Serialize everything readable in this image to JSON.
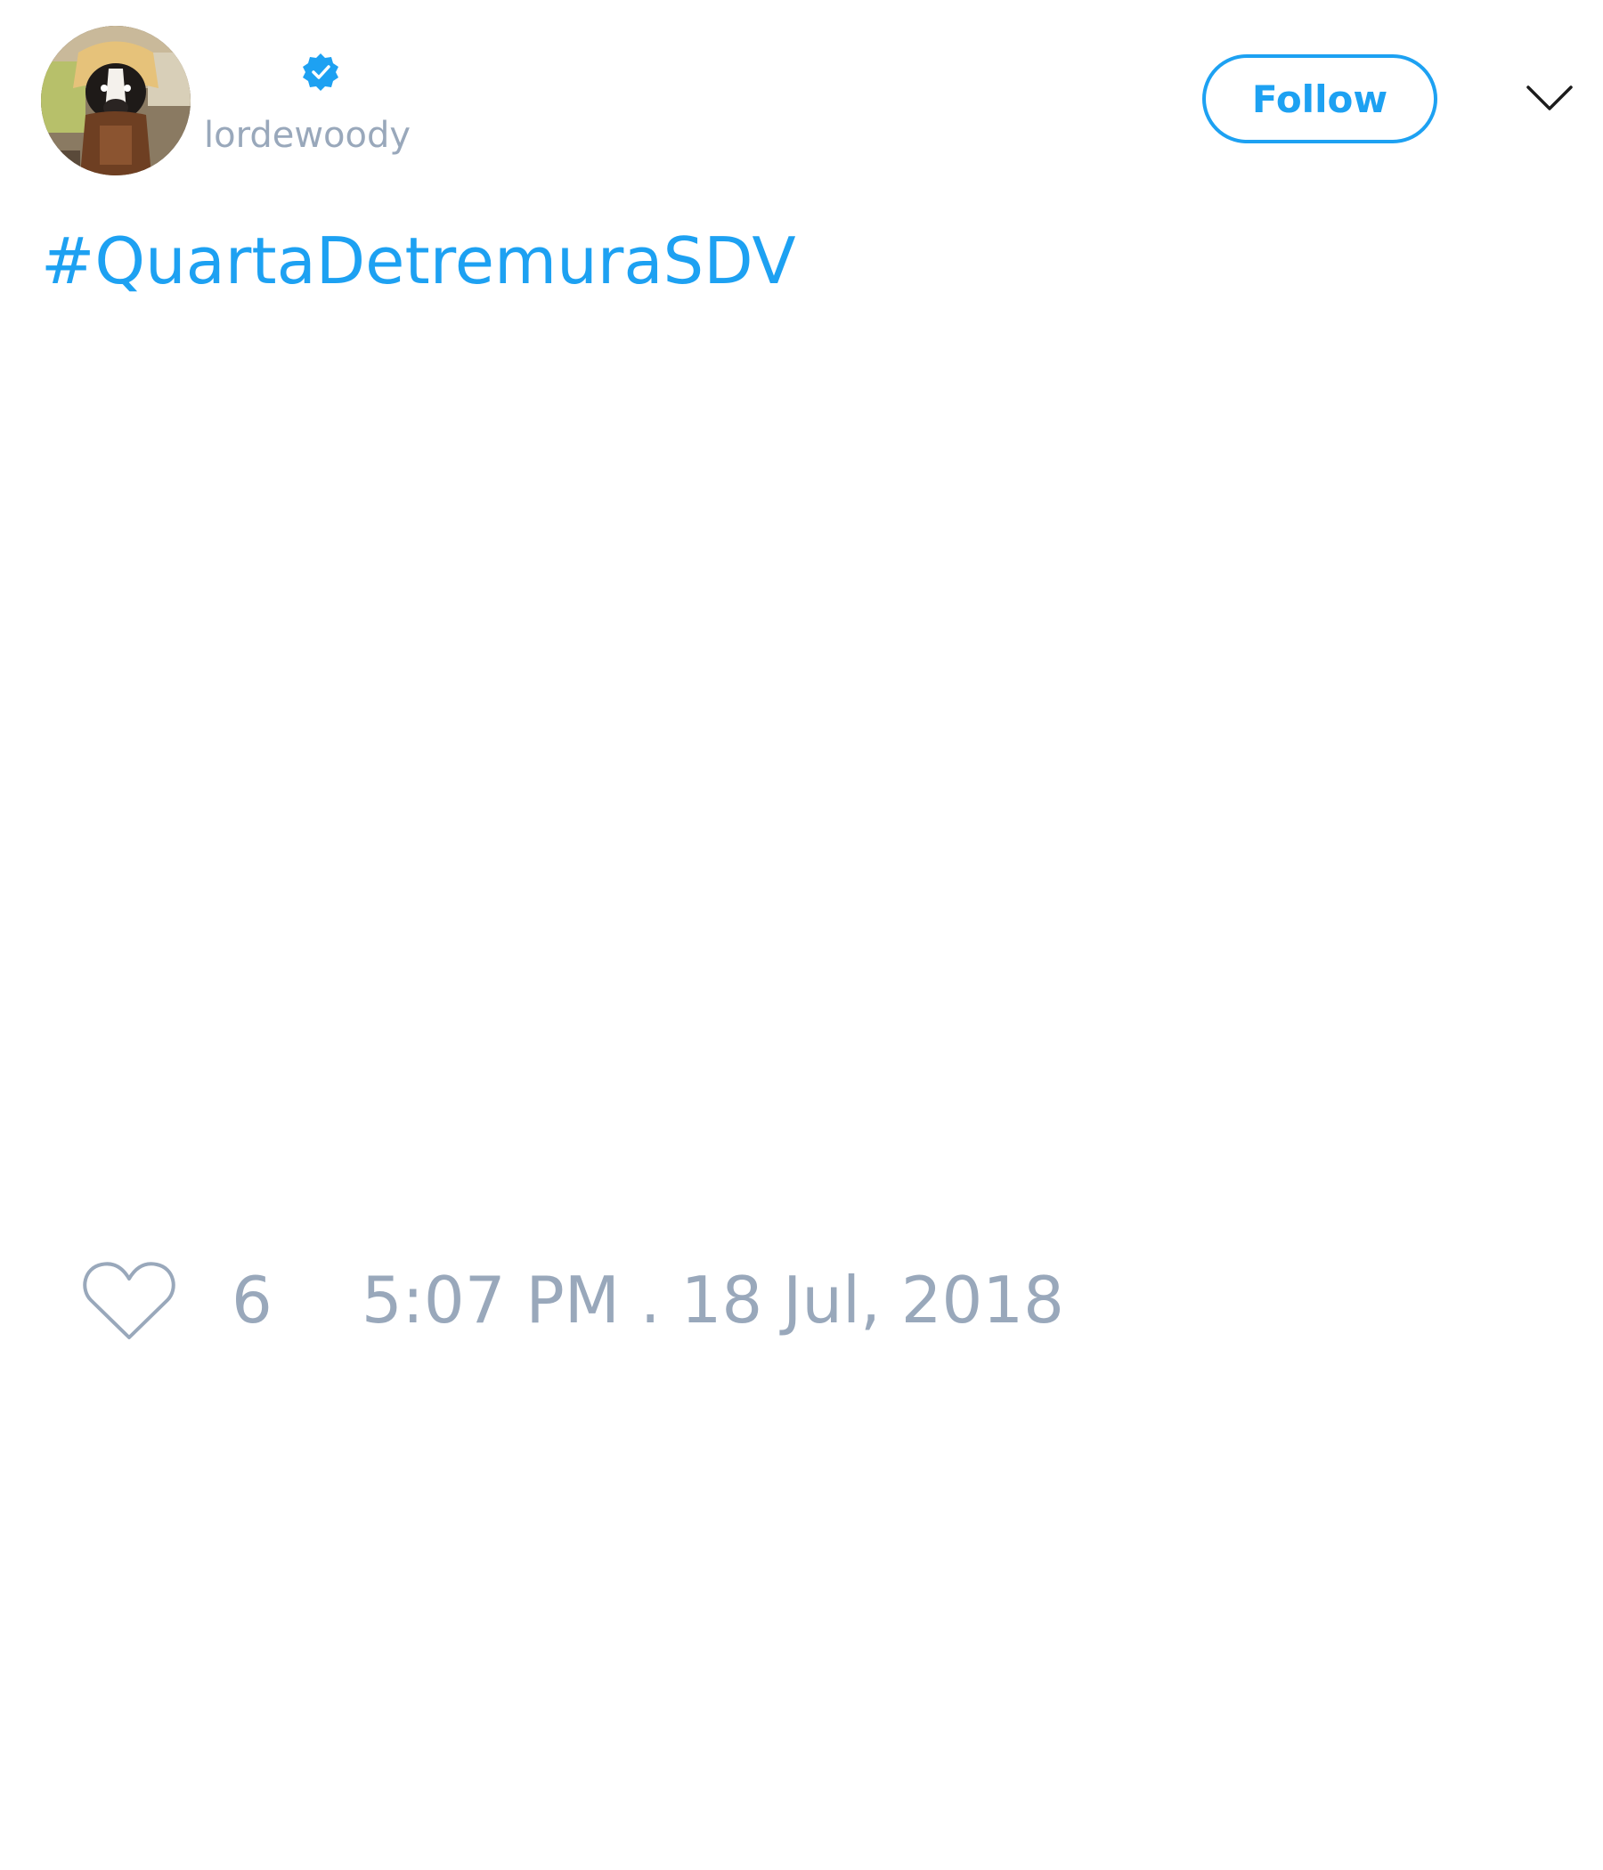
{
  "author": {
    "handle": "lordewoody",
    "verified": true,
    "avatar_icon": "dog-avatar-photo"
  },
  "header": {
    "follow_label": "Follow",
    "menu_icon": "chevron-down-icon"
  },
  "tweet": {
    "text": "#QuartaDetremuraSDV"
  },
  "footer": {
    "like_icon": "heart-outline-icon",
    "like_count": "6",
    "timestamp": "5:07 PM . 18 Jul, 2018"
  },
  "colors": {
    "accent": "#1da1f2",
    "muted_text": "#99a8bb",
    "background": "#ffffff"
  }
}
